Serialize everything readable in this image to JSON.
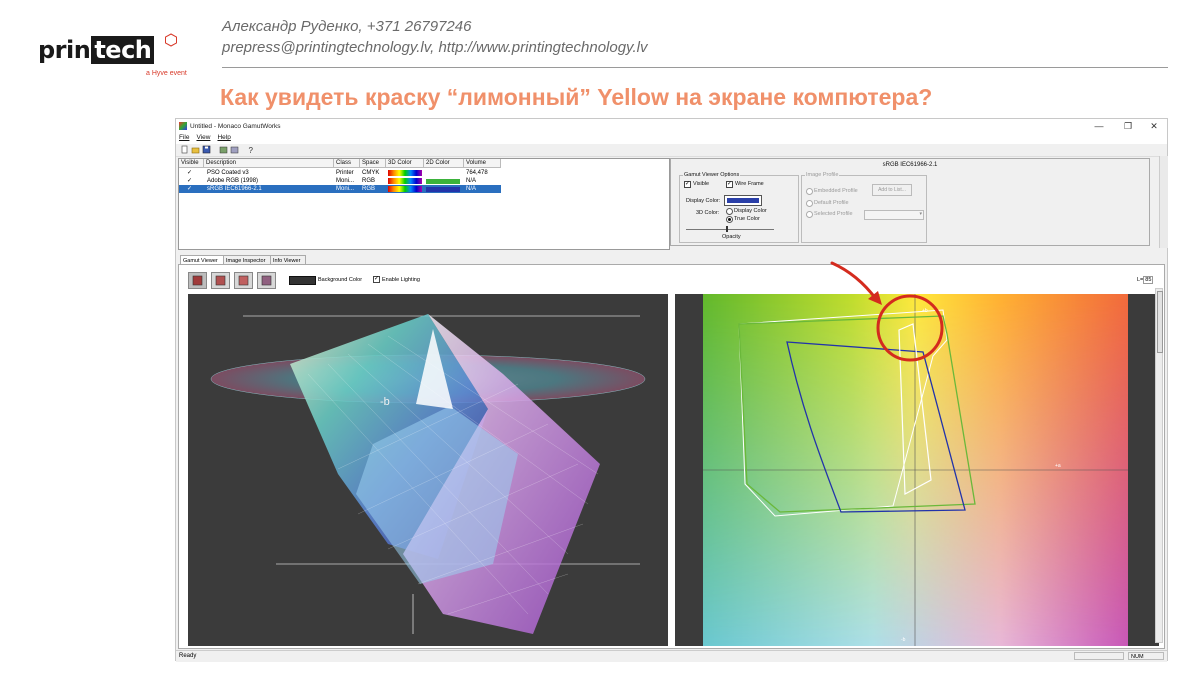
{
  "slide": {
    "logo": {
      "brand_left": "prin",
      "brand_right": "tech",
      "sub": "a Hyve event"
    },
    "contact_line1": "Александр Руденко, +371 26797246",
    "contact_line2": "prepress@printingtechnology.lv, http://www.printingtechnology.lv",
    "headline": "Как увидеть краску “лимонный” Yellow на экране компютера?",
    "accent_color": "#f0906a",
    "annotation_color": "#d42b1e"
  },
  "app": {
    "title": "Untitled - Monaco GamutWorks",
    "window_buttons": [
      "—",
      "❐",
      "✕"
    ],
    "menu": [
      "File",
      "View",
      "Help"
    ],
    "toolbar_icons": [
      "new-file-icon",
      "open-folder-icon",
      "save-icon",
      "import-icon",
      "export-icon",
      "help-icon"
    ],
    "profile_list": {
      "columns": [
        "Visible",
        "Description",
        "Class",
        "Space",
        "3D Color",
        "2D Color",
        "Volume"
      ],
      "rows": [
        {
          "visible": "✓",
          "description": "PSO Coated v3",
          "class": "Printer",
          "space": "CMYK",
          "color2d": "",
          "volume": "764,478",
          "selected": false
        },
        {
          "visible": "✓",
          "description": "Adobe RGB (1998)",
          "class": "Moni...",
          "space": "RGB",
          "color2d": "#3bb23b",
          "volume": "N/A",
          "selected": false
        },
        {
          "visible": "✓",
          "description": "sRGB IEC61966-2.1",
          "class": "Moni...",
          "space": "RGB",
          "color2d": "#2233aa",
          "volume": "N/A",
          "selected": true
        }
      ]
    },
    "options": {
      "profile_title": "sRGB IEC61966-2.1",
      "group_title": "Gamut Viewer Options",
      "visible_label": "Visible",
      "wireframe_label": "Wire Frame",
      "display_color_label": "Display Color:",
      "display_color": "#2a3fa8",
      "color3d_label": "3D Color:",
      "display_color_radio": "Display Color",
      "true_color_radio": "True Color",
      "opacity_label": "Opacity",
      "image_profile_title": "Image Profile",
      "embedded_profile": "Embedded Profile",
      "default_profile": "Default Profile",
      "selected_profile": "Selected Profile",
      "add_to_list": "Add to List..."
    },
    "tabs": [
      "Gamut Viewer",
      "Image Inspector",
      "Info Viewer"
    ],
    "viewer": {
      "background_color_label": "Background Color",
      "enable_lighting_label": "Enable Lighting",
      "background_color": "#333333",
      "l_label": "L=",
      "l_value": "85",
      "axis_b": "-b",
      "axis_plus_a": "+a",
      "axis_plus_b": "+b"
    },
    "status": {
      "text": "Ready",
      "num": "NUM"
    }
  }
}
